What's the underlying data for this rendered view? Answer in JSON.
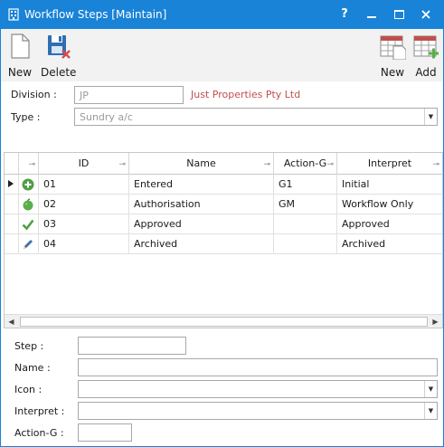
{
  "window": {
    "title": "Workflow Steps [Maintain]",
    "help": "?",
    "minimize": "▬",
    "maximize": "☐",
    "close": "✕"
  },
  "toolbar": {
    "new_label": "New",
    "delete_label": "Delete",
    "new_right_label": "New",
    "add_label": "Add"
  },
  "header": {
    "division_label": "Division :",
    "division_value": "JP",
    "division_name": "Just Properties Pty Ltd",
    "type_label": "Type :",
    "type_value": "Sundry a/c"
  },
  "grid": {
    "columns": [
      "ID",
      "Name",
      "Action-G",
      "Interpret"
    ],
    "rows": [
      {
        "id": "01",
        "name": "Entered",
        "action": "G1",
        "interpret": "Initial",
        "icon": "plus-circle-icon"
      },
      {
        "id": "02",
        "name": "Authorisation",
        "action": "GM",
        "interpret": "Workflow Only",
        "icon": "apple-icon"
      },
      {
        "id": "03",
        "name": "Approved",
        "action": "",
        "interpret": "Approved",
        "icon": "checkmark-icon"
      },
      {
        "id": "04",
        "name": "Archived",
        "action": "",
        "interpret": "Archived",
        "icon": "pencil-icon"
      }
    ]
  },
  "form": {
    "step_label": "Step :",
    "name_label": "Name :",
    "icon_label": "Icon :",
    "interpret_label": "Interpret :",
    "action_label": "Action-G :"
  },
  "colors": {
    "titlebar": "#1883d7",
    "link": "#c0504d",
    "accent_green": "#5cae4c"
  }
}
